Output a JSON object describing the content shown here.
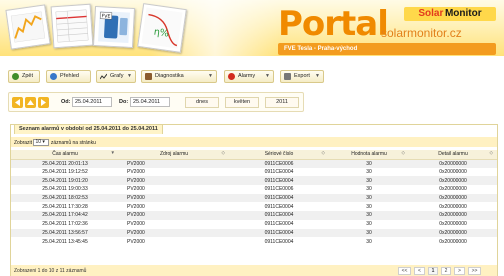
{
  "header": {
    "portal_word": "Portal",
    "brand_solar": "Solar",
    "brand_monitor": "Monitor",
    "site_url": "solarmonitor.cz",
    "station": "FVE Tesla - Praha-východ",
    "card_label": "FVE"
  },
  "toolbar": {
    "back": "Zpět",
    "overview": "Přehled",
    "charts": "Grafy",
    "diagnostics": "Diagnostika",
    "alarms": "Alarmy",
    "export": "Export"
  },
  "dates": {
    "from_label": "Od:",
    "from_value": "25.04.2011",
    "to_label": "Do:",
    "to_value": "25.04.2011",
    "today": "dnes",
    "month": "květen",
    "year": "2011"
  },
  "panel": {
    "title": "Seznam alarmů v období od 25.04.2011 do 25.04.2011",
    "show_prefix": "Zobrazit",
    "per_page": "10",
    "show_suffix": "záznamů na stránku",
    "columns": [
      "Čas alarmu",
      "Zdroj alarmu",
      "Sériové číslo",
      "Hodnota alarmu",
      "Detail alarmu"
    ],
    "rows": [
      [
        "25.04.2011 20:01:13",
        "PV2000",
        "0911CE0006",
        "30",
        "0x20000000"
      ],
      [
        "25.04.2011 19:12:52",
        "PV2000",
        "0911CE0004",
        "30",
        "0x20000000"
      ],
      [
        "25.04.2011 19:01:20",
        "PV2000",
        "0911CE0004",
        "30",
        "0x20000000"
      ],
      [
        "25.04.2011 19:00:33",
        "PV2000",
        "0911CE0006",
        "30",
        "0x20000000"
      ],
      [
        "25.04.2011 18:02:53",
        "PV2000",
        "0911CE0004",
        "30",
        "0x20000000"
      ],
      [
        "25.04.2011 17:30:28",
        "PV2000",
        "0911CE0004",
        "30",
        "0x20000000"
      ],
      [
        "25.04.2011 17:04:42",
        "PV2000",
        "0911CE0004",
        "30",
        "0x20000000"
      ],
      [
        "25.04.2011 17:02:36",
        "PV2000",
        "0911CE0004",
        "30",
        "0x20000000"
      ],
      [
        "25.04.2011 13:56:57",
        "PV2000",
        "0911CE0004",
        "30",
        "0x20000000"
      ],
      [
        "25.04.2011 13:45:45",
        "PV2000",
        "0911CE0004",
        "30",
        "0x20000000"
      ]
    ],
    "footer_info": "Zobrazeni 1 do 10 z 11 záznamů",
    "pager": [
      "<<",
      "<",
      "1",
      "2",
      ">",
      ">>"
    ],
    "active_page": "1"
  },
  "colors": {
    "accent_orange": "#f08a00",
    "banner_yellow": "#ffe27a",
    "station_bar": "#f39c1f",
    "brand_red": "#e23a1e"
  }
}
